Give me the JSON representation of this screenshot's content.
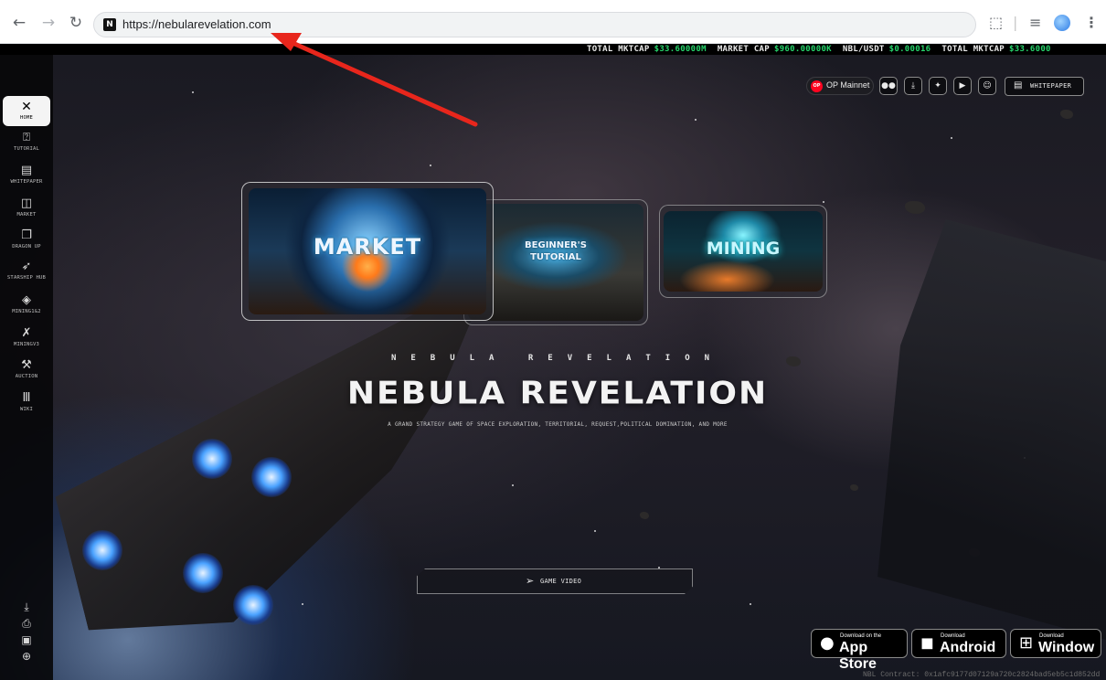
{
  "browser": {
    "url": "https://nebularevelation.com",
    "favicon_glyph": "N"
  },
  "ticker": [
    {
      "label": "TOTAL MKTCAP",
      "value": "$33.60000M"
    },
    {
      "label": "MARKET CAP",
      "value": "$960.00000K"
    },
    {
      "label": "NBL/USDT",
      "value": "$0.00016"
    },
    {
      "label": "TOTAL MKTCAP",
      "value": "$33.6000"
    }
  ],
  "sidebar": {
    "items": [
      {
        "label": "HOME",
        "icon": "nebula-logo-icon"
      },
      {
        "label": "TUTORIAL",
        "icon": "question-icon"
      },
      {
        "label": "WHITEPAPER",
        "icon": "document-icon"
      },
      {
        "label": "MARKET",
        "icon": "market-icon"
      },
      {
        "label": "DRAGON UP",
        "icon": "copy-icon"
      },
      {
        "label": "STARSHIP HUB",
        "icon": "rocket-icon"
      },
      {
        "label": "MINING1&2",
        "icon": "diamond-icon"
      },
      {
        "label": "MININGV3",
        "icon": "crossed-tools-icon"
      },
      {
        "label": "AUCTION",
        "icon": "gavel-icon"
      },
      {
        "label": "WIKI",
        "icon": "library-icon"
      }
    ],
    "bottom_icons": [
      "download-icon",
      "sign-icon",
      "profile-card-icon",
      "globe-icon"
    ]
  },
  "network": {
    "badge": "OP",
    "label": "OP Mainnet"
  },
  "social_icons": [
    "medium-icon",
    "download-icon",
    "twitter-icon",
    "youtube-icon",
    "discord-icon"
  ],
  "whitepaper_button": "WHITEPAPER",
  "cards": [
    {
      "title": "MARKET"
    },
    {
      "title_line1": "BEGINNER'S",
      "title_line2": "TUTORIAL"
    },
    {
      "title": "MINING"
    }
  ],
  "hero": {
    "spaced_title": "NEBULA REVELATION",
    "title": "NEBULA REVELATION",
    "subtitle": "A GRAND STRATEGY GAME OF SPACE EXPLORATION, TERRITORIAL, REQUEST,POLITICAL DOMINATION, AND MORE",
    "video_button": "GAME VIDEO"
  },
  "stores": [
    {
      "small": "Download on the",
      "big": "App Store",
      "icon": "apple-icon"
    },
    {
      "small": "Download",
      "big": "Android",
      "icon": "android-icon"
    },
    {
      "small": "Download",
      "big": "Window",
      "icon": "windows-icon"
    }
  ],
  "footer_hash": "NBL Contract: 0x1afc9177d07129a720c2824bad5eb5c1d852dd",
  "colors": {
    "ticker_value": "#25d36a",
    "op_red": "#ff0420",
    "annotation_arrow": "#e8261c"
  }
}
